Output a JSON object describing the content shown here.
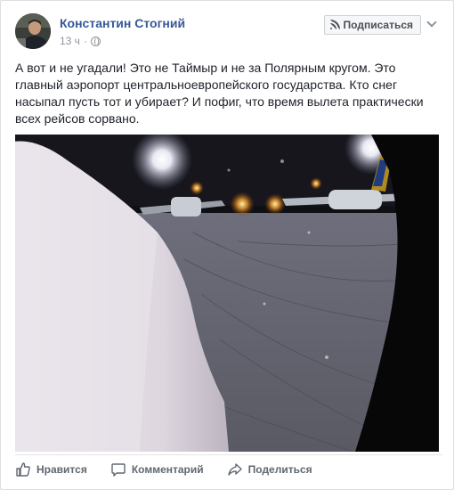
{
  "post": {
    "author": "Константин Стогний",
    "time": "13 ч",
    "privacy_icon": "globe-icon",
    "subscribe_label": "Подписаться",
    "subscribe_icon": "rss-icon",
    "menu_icon": "chevron-down-icon",
    "text": "А вот и не угадали! Это не Таймыр и не за Полярным кругом. Это главный аэропорт центральноевропейского государства. Кто снег насыпал пусть тот и убирает? И пофиг, что время вылета практически всех рейсов сорвано."
  },
  "actions": {
    "like": "Нравится",
    "comment": "Комментарий",
    "share": "Поделиться"
  },
  "colors": {
    "link": "#365899",
    "text": "#1d2129",
    "meta": "#90949c",
    "action": "#606770"
  }
}
